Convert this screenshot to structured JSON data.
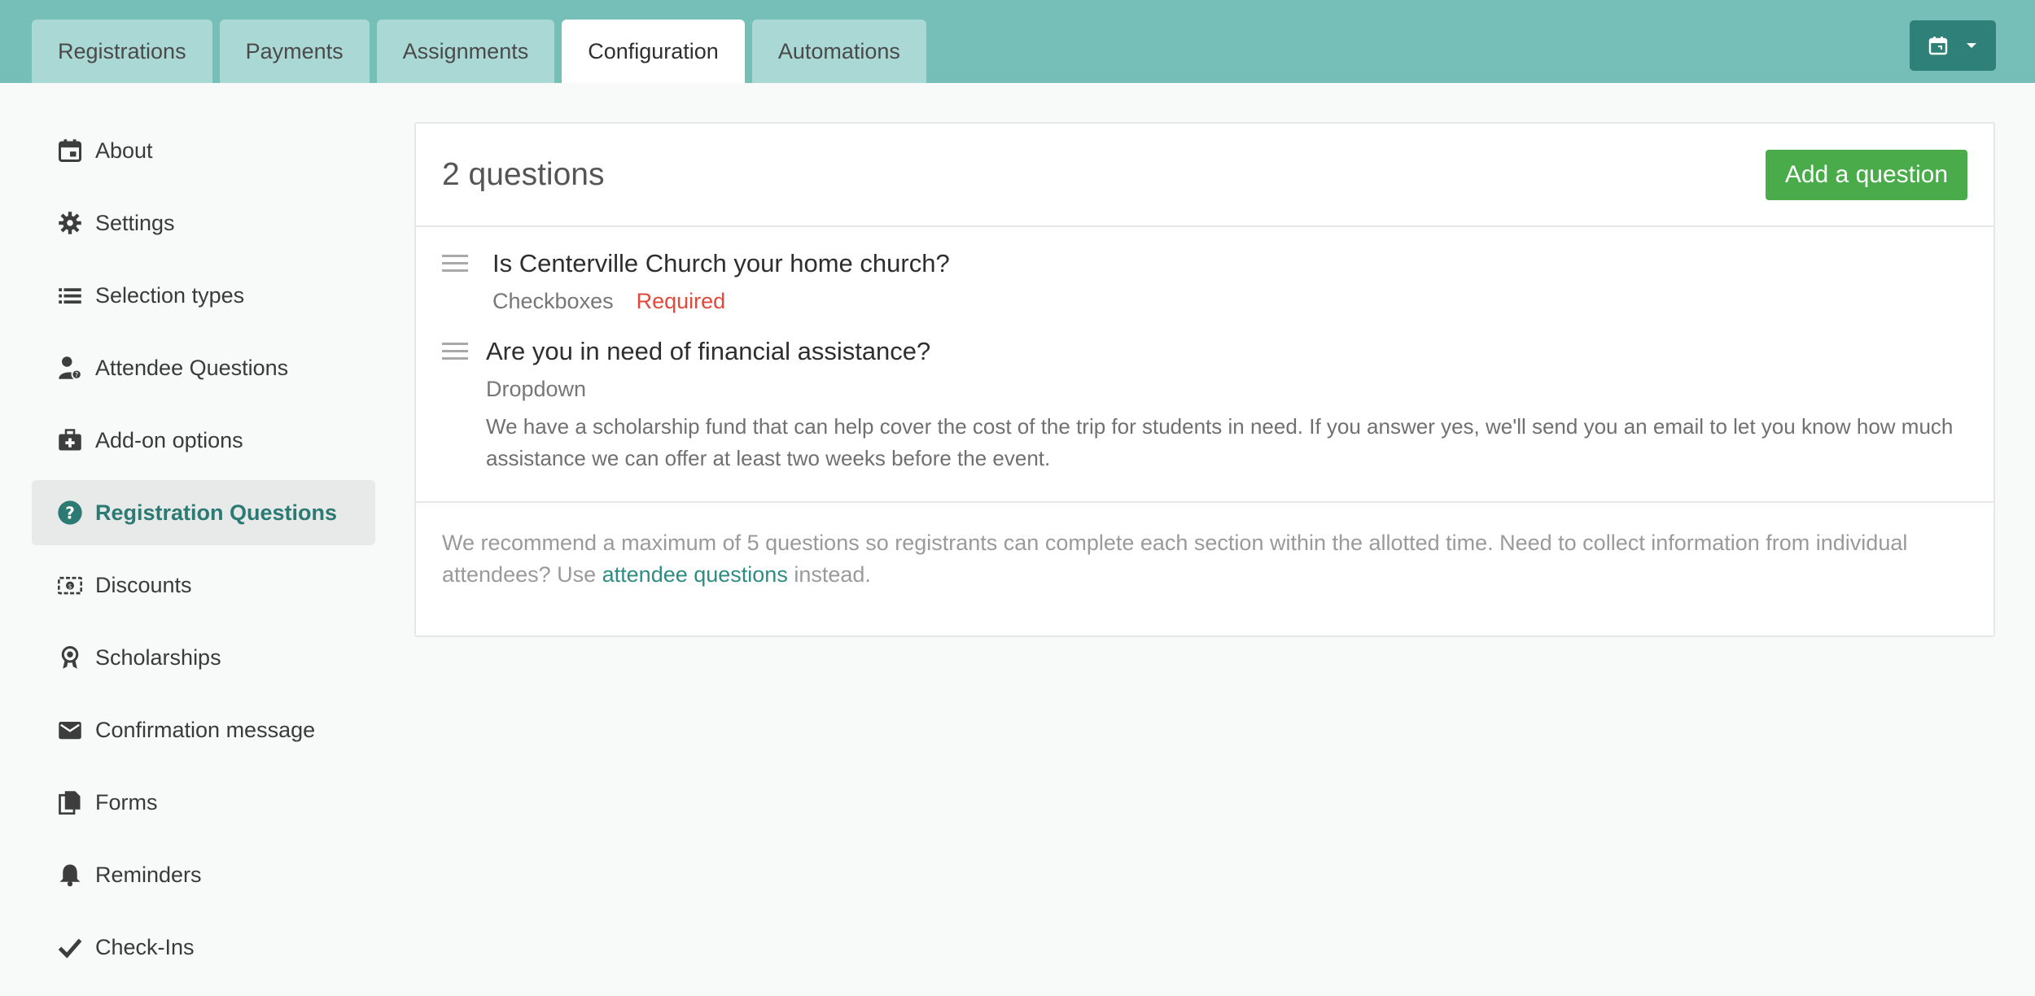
{
  "tabs": [
    {
      "label": "Registrations",
      "active": false
    },
    {
      "label": "Payments",
      "active": false
    },
    {
      "label": "Assignments",
      "active": false
    },
    {
      "label": "Configuration",
      "active": true
    },
    {
      "label": "Automations",
      "active": false
    }
  ],
  "header": {
    "calendar_icon": "calendar-icon",
    "dropdown_icon": "caret-down-icon"
  },
  "sidebar": {
    "items": [
      {
        "label": "About",
        "icon": "calendar-icon"
      },
      {
        "label": "Settings",
        "icon": "gear-icon"
      },
      {
        "label": "Selection types",
        "icon": "list-icon"
      },
      {
        "label": "Attendee Questions",
        "icon": "person-question-icon"
      },
      {
        "label": "Add-on options",
        "icon": "medkit-icon"
      },
      {
        "label": "Registration Questions",
        "icon": "question-circle-icon",
        "active": true
      },
      {
        "label": "Discounts",
        "icon": "discount-icon"
      },
      {
        "label": "Scholarships",
        "icon": "award-icon"
      },
      {
        "label": "Confirmation message",
        "icon": "envelope-icon"
      },
      {
        "label": "Forms",
        "icon": "documents-icon"
      },
      {
        "label": "Reminders",
        "icon": "bell-icon"
      },
      {
        "label": "Check-Ins",
        "icon": "check-icon"
      }
    ]
  },
  "main": {
    "title": "2 questions",
    "add_button": "Add a question",
    "questions": [
      {
        "title": "Is Centerville Church your home church?",
        "type": "Checkboxes",
        "required": "Required",
        "description": ""
      },
      {
        "title": "Are you in need of financial assistance?",
        "type": "Dropdown",
        "required": "",
        "description": "We have a scholarship fund that can help cover the cost of the trip for students in need. If you answer yes, we'll send you an email to let you know how much assistance we can offer at least two weeks before the event."
      }
    ],
    "note": {
      "before": "We recommend a maximum of 5 questions so registrants can complete each section within the allotted time. Need to collect information from individual attendees? Use ",
      "link": "attendee questions",
      "after": " instead."
    }
  },
  "colors": {
    "topbar": "#76bfb8",
    "tab_inactive": "#aad9d5",
    "accent": "#2f8078",
    "add_button": "#4aab4b",
    "required": "#e0493c"
  }
}
